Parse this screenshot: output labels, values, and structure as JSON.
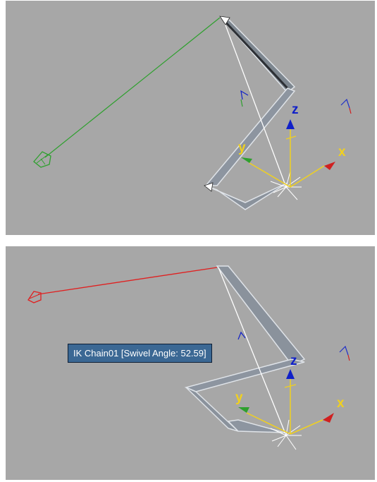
{
  "colors": {
    "viewport_bg": "#a7a7a7",
    "bone": "#8a929c",
    "swivel_handle_idle": "#2ea02e",
    "swivel_handle_active": "#e02020",
    "axis_x": "#f0d020",
    "axis_y": "#f0d020",
    "axis_z": "#1020c8",
    "tooltip_bg": "#3b6894"
  },
  "viewport_top": {
    "axis_labels": {
      "x": "x",
      "y": "y",
      "z": "z"
    },
    "icons": [
      "swivel-handle-icon",
      "transform-gizmo-icon",
      "bone-chain-icon"
    ]
  },
  "viewport_bottom": {
    "tooltip": "IK Chain01 [Swivel Angle: 52.59]",
    "axis_labels": {
      "x": "x",
      "y": "y",
      "z": "z"
    },
    "icons": [
      "swivel-handle-icon",
      "transform-gizmo-icon",
      "bone-chain-icon"
    ]
  }
}
